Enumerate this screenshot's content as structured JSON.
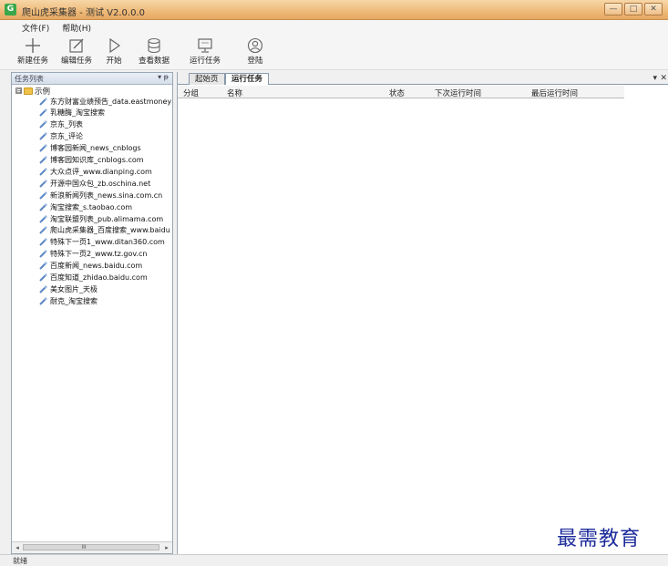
{
  "window": {
    "title": "爬山虎采集器 - 测试 V2.0.0.0",
    "app_icon": "G",
    "controls": {
      "minimize": "—",
      "maximize": "□",
      "close": "✕"
    }
  },
  "menu": [
    "文件(F)",
    "帮助(H)"
  ],
  "toolbar": {
    "new_task": "新建任务",
    "edit_task": "编辑任务",
    "start": "开始",
    "view_data": "查看数据",
    "run_task": "运行任务",
    "login": "登陆"
  },
  "left_panel": {
    "title": "任务列表",
    "pin": "▾ ᵽ",
    "root": {
      "expander": "⊟",
      "label": "示例"
    },
    "items": [
      "东方财富业绩预告_data.eastmoney",
      "乳糖酶_淘宝搜索",
      "京东_列表",
      "京东_评论",
      "博客园新闻_news_cnblogs",
      "博客园知识库_cnblogs.com",
      "大众点评_www.dianping.com",
      "开源中国众包_zb.oschina.net",
      "新浪新闻列表_news.sina.com.cn",
      "淘宝搜索_s.taobao.com",
      "淘宝联盟列表_pub.alimama.com",
      "爬山虎采集器_百度搜索_www.baidu",
      "特殊下一页1_www.ditan360.com",
      "特殊下一页2_www.tz.gov.cn",
      "百度新闻_news.baidu.com",
      "百度知道_zhidao.baidu.com",
      "美女图片_天极",
      "耐克_淘宝搜索"
    ],
    "scroll": {
      "left": "◂",
      "right": "▸",
      "grip": "III"
    }
  },
  "tabs": {
    "items": [
      "起始页",
      "运行任务"
    ],
    "active": 1,
    "menu": "▾",
    "close": "✕"
  },
  "grid": {
    "columns": [
      "分组",
      "名称",
      "状态",
      "下次运行时间",
      "最后运行时间"
    ]
  },
  "status": "就绪",
  "watermark": "最需教育",
  "colors": {
    "accent": "#eeb978",
    "panel_border": "#9aa7b6",
    "watermark": "#1d2c9b"
  }
}
